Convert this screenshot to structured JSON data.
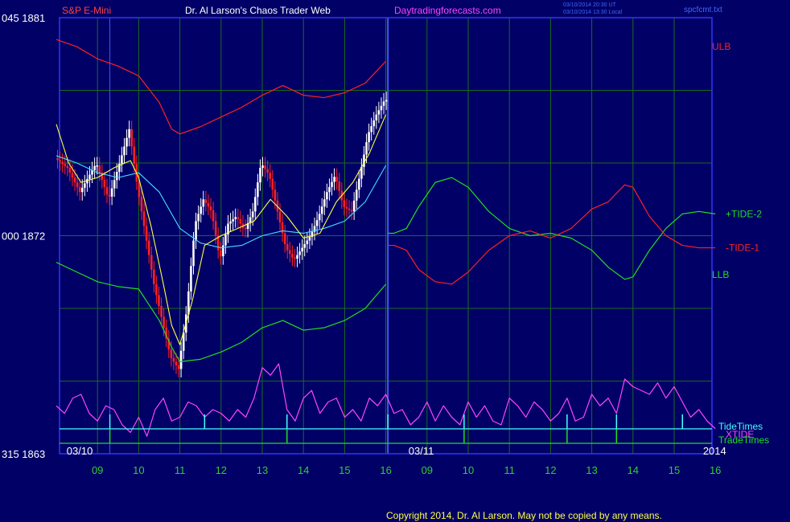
{
  "header": {
    "instrument": "S&P E-Mini",
    "author": "Dr. Al Larson's Chaos Trader Web",
    "site": "Daytradingforecasts.com",
    "stamp_line1": "03/10/2014 20:30 UT",
    "stamp_line2": "03/10/2014 13:30 Local",
    "filename": "spcfcmt.txt"
  },
  "footer": {
    "copyright": "Copyright 2014, Dr. Al Larson. May not be copied by any means."
  },
  "colors": {
    "background": "#000066",
    "panel_border": "#3333ff",
    "grid": "#1a6b1a",
    "price_up": "#ffffff",
    "price_down": "#ff2020",
    "ulb": "#ff2020",
    "llb": "#22dd22",
    "tide_plus": "#22dd22",
    "tide_minus": "#ff2020",
    "fast_ma": "#ffff44",
    "slow_ma": "#44ddff",
    "xtide": "#ff44ff",
    "tide_times": "#44ffff",
    "trade_times": "#22dd22",
    "xaxis_labels": "#33cc33"
  },
  "chart_data": {
    "type": "line",
    "title": "S&P E-Mini",
    "y_axis": {
      "min": 1863,
      "max": 1881,
      "ticks": [
        {
          "value": 1881,
          "text": "045 1881"
        },
        {
          "value": 1872,
          "text": "000 1872"
        },
        {
          "value": 1863,
          "text": "315 1863"
        }
      ]
    },
    "x_axis": {
      "min": 8.0,
      "max": 24.0,
      "tick_labels": [
        {
          "x": 9,
          "text": "09"
        },
        {
          "x": 10,
          "text": "10"
        },
        {
          "x": 11,
          "text": "11"
        },
        {
          "x": 12,
          "text": "12"
        },
        {
          "x": 13,
          "text": "13"
        },
        {
          "x": 14,
          "text": "14"
        },
        {
          "x": 15,
          "text": "15"
        },
        {
          "x": 16,
          "text": "16"
        },
        {
          "x": 17,
          "text": "09"
        },
        {
          "x": 18,
          "text": "10"
        },
        {
          "x": 19,
          "text": "11"
        },
        {
          "x": 20,
          "text": "12"
        },
        {
          "x": 21,
          "text": "13"
        },
        {
          "x": 22,
          "text": "14"
        },
        {
          "x": 23,
          "text": "15"
        },
        {
          "x": 24,
          "text": "16"
        }
      ],
      "date_labels": [
        {
          "x": 8.25,
          "text": "03/10"
        },
        {
          "x": 16.55,
          "text": "03/11"
        },
        {
          "x": 23.7,
          "text": "2014"
        }
      ],
      "session_break": 16.05
    },
    "series_labels": [
      {
        "name": "ULB",
        "series": "ulb",
        "y": 1879.8
      },
      {
        "name": "+TIDE-2",
        "series": "tide_plus",
        "y": 1872.9
      },
      {
        "name": "-TIDE-1",
        "series": "tide_minus",
        "y": 1871.5
      },
      {
        "name": "LLB",
        "series": "llb",
        "y": 1870.4
      }
    ],
    "ulb": {
      "x": [
        8.0,
        8.5,
        9.0,
        9.5,
        10.0,
        10.5,
        10.8,
        11.0,
        11.5,
        12.0,
        12.5,
        13.0,
        13.5,
        14.0,
        14.5,
        15.0,
        15.5,
        16.0
      ],
      "y": [
        1880.1,
        1879.8,
        1879.3,
        1879.0,
        1878.6,
        1877.5,
        1876.4,
        1876.2,
        1876.5,
        1876.9,
        1877.3,
        1877.8,
        1878.2,
        1877.8,
        1877.7,
        1877.9,
        1878.3,
        1879.2
      ]
    },
    "llb": {
      "x": [
        8.0,
        8.5,
        9.0,
        9.5,
        10.0,
        10.5,
        10.8,
        11.0,
        11.5,
        12.0,
        12.5,
        13.0,
        13.5,
        14.0,
        14.5,
        15.0,
        15.5,
        16.0
      ],
      "y": [
        1870.9,
        1870.5,
        1870.1,
        1869.9,
        1869.8,
        1868.5,
        1867.4,
        1866.8,
        1866.9,
        1867.2,
        1867.6,
        1868.2,
        1868.5,
        1868.1,
        1868.2,
        1868.5,
        1869.0,
        1870.0
      ]
    },
    "price": {
      "x": [
        8.0,
        8.3,
        8.6,
        9.0,
        9.3,
        9.6,
        9.8,
        10.0,
        10.2,
        10.4,
        10.6,
        10.8,
        11.0,
        11.2,
        11.4,
        11.6,
        11.8,
        12.0,
        12.2,
        12.4,
        12.6,
        12.8,
        13.0,
        13.2,
        13.4,
        13.6,
        13.8,
        14.0,
        14.2,
        14.4,
        14.6,
        14.8,
        15.0,
        15.2,
        15.4,
        15.6,
        15.8,
        16.0
      ],
      "y": [
        1875.2,
        1874.8,
        1873.8,
        1875.0,
        1873.5,
        1875.2,
        1876.4,
        1874.0,
        1872.0,
        1870.0,
        1868.5,
        1867.0,
        1866.5,
        1869.0,
        1872.5,
        1873.5,
        1873.0,
        1871.0,
        1872.5,
        1872.8,
        1872.2,
        1873.0,
        1875.0,
        1874.5,
        1873.0,
        1871.5,
        1871.0,
        1871.5,
        1872.0,
        1872.8,
        1873.8,
        1874.5,
        1873.2,
        1873.0,
        1874.5,
        1876.2,
        1877.0,
        1877.6
      ]
    },
    "fast_ma": {
      "x": [
        8.0,
        8.3,
        8.6,
        9.0,
        9.4,
        9.8,
        10.0,
        10.3,
        10.6,
        10.8,
        11.0,
        11.3,
        11.6,
        12.0,
        12.4,
        12.8,
        13.2,
        13.6,
        14.0,
        14.4,
        14.8,
        15.2,
        15.6,
        16.0
      ],
      "y": [
        1876.6,
        1875.0,
        1874.2,
        1874.4,
        1874.8,
        1875.1,
        1874.4,
        1872.4,
        1870.0,
        1868.3,
        1867.5,
        1869.3,
        1871.6,
        1872.0,
        1872.3,
        1872.6,
        1873.5,
        1872.8,
        1871.9,
        1872.1,
        1873.4,
        1874.2,
        1875.4,
        1877.0
      ]
    },
    "slow_ma": {
      "x": [
        8.0,
        8.5,
        9.0,
        9.5,
        10.0,
        10.5,
        11.0,
        11.5,
        12.0,
        12.5,
        13.0,
        13.5,
        14.0,
        14.5,
        15.0,
        15.5,
        16.0
      ],
      "y": [
        1875.3,
        1875.0,
        1874.6,
        1874.4,
        1874.6,
        1873.8,
        1872.3,
        1871.7,
        1871.5,
        1871.6,
        1872.0,
        1872.2,
        1872.1,
        1872.3,
        1872.6,
        1873.4,
        1874.9
      ]
    },
    "tide_plus": {
      "x": [
        16.05,
        16.2,
        16.5,
        16.8,
        17.2,
        17.6,
        18.0,
        18.5,
        19.0,
        19.5,
        20.0,
        20.5,
        21.0,
        21.4,
        21.8,
        22.0,
        22.4,
        22.8,
        23.2,
        23.6,
        24.0
      ],
      "y": [
        1872.1,
        1872.1,
        1872.3,
        1873.2,
        1874.2,
        1874.4,
        1874.0,
        1873.0,
        1872.3,
        1872.0,
        1872.1,
        1871.9,
        1871.4,
        1870.7,
        1870.2,
        1870.3,
        1871.4,
        1872.3,
        1872.9,
        1873.0,
        1872.9
      ]
    },
    "tide_minus": {
      "x": [
        16.05,
        16.2,
        16.5,
        16.8,
        17.2,
        17.6,
        18.0,
        18.5,
        19.0,
        19.5,
        20.0,
        20.5,
        21.0,
        21.4,
        21.8,
        22.0,
        22.4,
        22.8,
        23.2,
        23.6,
        24.0
      ],
      "y": [
        1871.6,
        1871.6,
        1871.4,
        1870.6,
        1870.1,
        1870.0,
        1870.5,
        1871.4,
        1872.0,
        1872.2,
        1871.9,
        1872.3,
        1873.1,
        1873.4,
        1874.1,
        1874.0,
        1872.8,
        1872.0,
        1871.6,
        1871.5,
        1871.5
      ]
    },
    "tide_times": [
      9.3,
      11.6,
      13.6,
      16.05,
      17.9,
      20.4,
      21.6,
      23.2
    ],
    "trade_times": [
      9.3,
      13.6,
      17.9,
      20.4,
      21.6
    ],
    "tide_label": "TideTimes",
    "trade_label": "TradeTimes",
    "xtide_label": "XTIDE",
    "xtide": {
      "x": [
        8.0,
        8.2,
        8.4,
        8.6,
        8.8,
        9.0,
        9.2,
        9.4,
        9.6,
        9.8,
        10.0,
        10.2,
        10.4,
        10.6,
        10.8,
        11.0,
        11.2,
        11.4,
        11.6,
        11.8,
        12.0,
        12.2,
        12.4,
        12.6,
        12.8,
        13.0,
        13.2,
        13.4,
        13.6,
        13.8,
        14.0,
        14.2,
        14.4,
        14.6,
        14.8,
        15.0,
        15.2,
        15.4,
        15.6,
        15.8,
        16.0,
        16.2,
        16.4,
        16.6,
        16.8,
        17.0,
        17.2,
        17.4,
        17.6,
        17.8,
        18.0,
        18.2,
        18.4,
        18.6,
        18.8,
        19.0,
        19.2,
        19.4,
        19.6,
        19.8,
        20.0,
        20.2,
        20.4,
        20.6,
        20.8,
        21.0,
        21.2,
        21.4,
        21.6,
        21.8,
        22.0,
        22.2,
        22.4,
        22.6,
        22.8,
        23.0,
        23.2,
        23.4,
        23.6,
        23.8,
        24.0
      ],
      "y": [
        0.45,
        0.35,
        0.55,
        0.6,
        0.35,
        0.25,
        0.45,
        0.4,
        0.2,
        0.1,
        0.3,
        0.05,
        0.4,
        0.55,
        0.25,
        0.3,
        0.5,
        0.45,
        0.3,
        0.4,
        0.35,
        0.25,
        0.4,
        0.3,
        0.55,
        0.95,
        0.85,
        1.0,
        0.4,
        0.25,
        0.55,
        0.65,
        0.35,
        0.5,
        0.55,
        0.3,
        0.4,
        0.25,
        0.55,
        0.45,
        0.6,
        0.35,
        0.4,
        0.2,
        0.3,
        0.5,
        0.25,
        0.45,
        0.3,
        0.2,
        0.5,
        0.3,
        0.45,
        0.25,
        0.2,
        0.55,
        0.45,
        0.3,
        0.5,
        0.4,
        0.25,
        0.35,
        0.55,
        0.25,
        0.3,
        0.6,
        0.45,
        0.55,
        0.35,
        0.8,
        0.7,
        0.65,
        0.6,
        0.75,
        0.55,
        0.7,
        0.5,
        0.3,
        0.4,
        0.25,
        0.15
      ]
    }
  }
}
